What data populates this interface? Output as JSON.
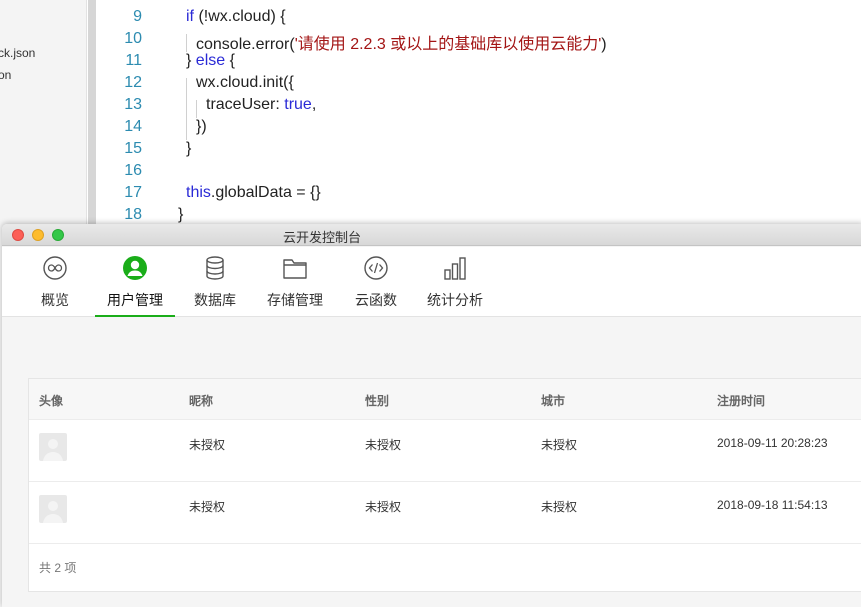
{
  "file_panel": {
    "items": [
      "ck.json",
      "on"
    ]
  },
  "editor": {
    "line_numbers": [
      "9",
      "10",
      "11",
      "12",
      "13",
      "14",
      "15",
      "16",
      "17",
      "18"
    ],
    "lines": [
      {
        "pre": "if (!wx.cloud) {",
        "kw": "if"
      },
      {
        "call": "console.error(",
        "str": "'请使用 2.2.3 或以上的基础库以使用云能力'",
        "post": ")"
      },
      {
        "a": "} ",
        "kw": "else",
        "b": " {"
      },
      {
        "text": "wx.cloud.init({"
      },
      {
        "a": "traceUser: ",
        "kw": "true",
        "b": ","
      },
      {
        "text": "})"
      },
      {
        "text": "}"
      },
      {
        "text": ""
      },
      {
        "kw": "this",
        "b": ".globalData = {}"
      },
      {
        "text": "}"
      }
    ]
  },
  "window": {
    "title": "云开发控制台",
    "controls": {
      "close_color": "#fc5f57",
      "minimize_color": "#fdbc2e",
      "zoom_color": "#33c748"
    },
    "accent_color": "#1aad19",
    "tabs": [
      {
        "label": "概览",
        "icon": "overview-icon"
      },
      {
        "label": "用户管理",
        "icon": "user-management-icon",
        "active": true
      },
      {
        "label": "数据库",
        "icon": "database-icon"
      },
      {
        "label": "存储管理",
        "icon": "storage-icon"
      },
      {
        "label": "云函数",
        "icon": "cloud-function-icon"
      },
      {
        "label": "统计分析",
        "icon": "statistics-icon"
      }
    ]
  },
  "users_table": {
    "columns": [
      "头像",
      "昵称",
      "性别",
      "城市",
      "注册时间"
    ],
    "rows": [
      {
        "nickname": "未授权",
        "gender": "未授权",
        "city": "未授权",
        "registered": "2018-09-11 20:28:23"
      },
      {
        "nickname": "未授权",
        "gender": "未授权",
        "city": "未授权",
        "registered": "2018-09-18 11:54:13"
      }
    ],
    "total": "共 2 项"
  }
}
